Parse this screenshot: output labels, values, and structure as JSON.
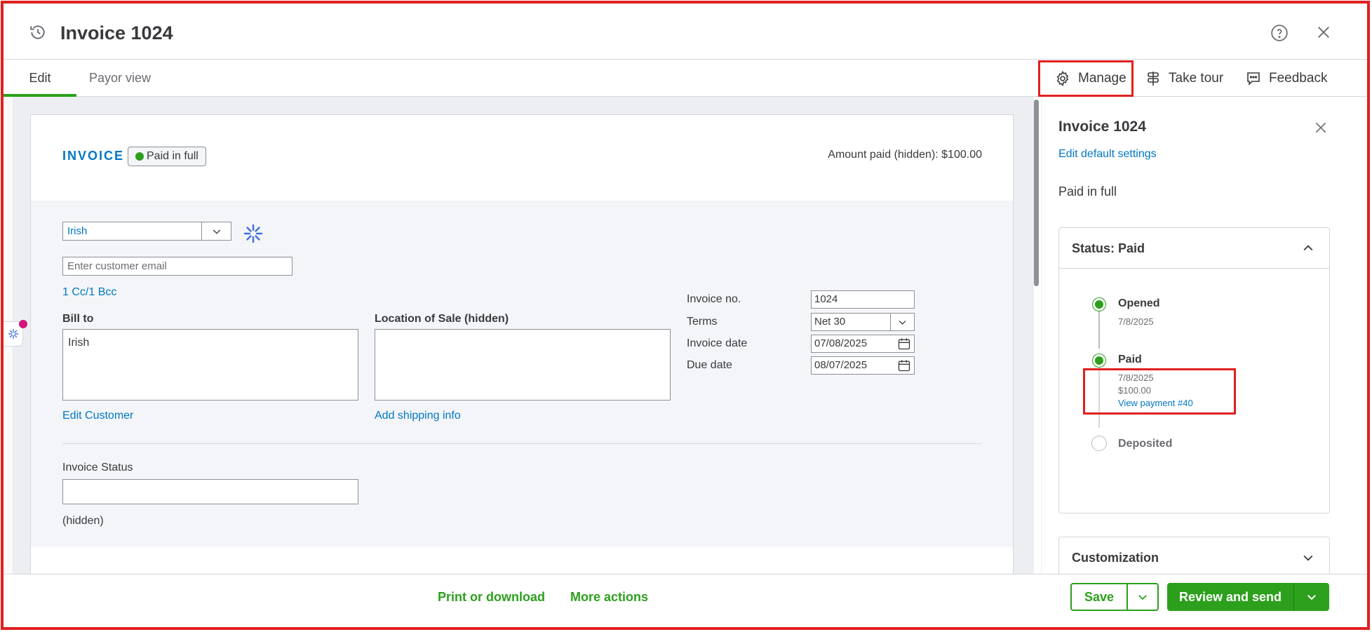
{
  "header": {
    "title": "Invoice 1024",
    "icons": [
      "history-icon",
      "help-icon",
      "close-icon"
    ]
  },
  "tabs": [
    {
      "label": "Edit",
      "active": true
    },
    {
      "label": "Payor view",
      "active": false
    }
  ],
  "toolbar": {
    "manage": "Manage",
    "take_tour": "Take tour",
    "feedback": "Feedback"
  },
  "invoice": {
    "heading": "INVOICE",
    "status_pill": "Paid in full",
    "amount_paid": "Amount paid (hidden): $100.00",
    "customer": "Irish",
    "email_placeholder": "Enter customer email",
    "cc_bcc": "1 Cc/1 Bcc",
    "bill_to_label": "Bill to",
    "bill_to_value": "Irish",
    "location_label": "Location of Sale (hidden)",
    "edit_customer": "Edit Customer",
    "add_shipping": "Add shipping info",
    "meta": {
      "invoice_no_label": "Invoice no.",
      "invoice_no": "1024",
      "terms_label": "Terms",
      "terms": "Net 30",
      "invoice_date_label": "Invoice date",
      "invoice_date": "07/08/2025",
      "due_date_label": "Due date",
      "due_date": "08/07/2025"
    },
    "invoice_status_label": "Invoice Status",
    "invoice_status_note": "(hidden)"
  },
  "panel": {
    "title": "Invoice 1024",
    "edit_defaults": "Edit default settings",
    "status_text": "Paid in full",
    "status_card_title": "Status: Paid",
    "timeline": {
      "opened": {
        "title": "Opened",
        "date": "7/8/2025"
      },
      "paid": {
        "title": "Paid",
        "date": "7/8/2025",
        "amount": "$100.00",
        "link": "View payment #40"
      },
      "deposited": {
        "title": "Deposited"
      }
    },
    "customization_title": "Customization"
  },
  "footer": {
    "print": "Print or download",
    "more": "More actions",
    "save": "Save",
    "review_send": "Review and send"
  },
  "colors": {
    "brand_green": "#2ca01c",
    "link_blue": "#0077c5",
    "highlight_red": "#e02020"
  }
}
